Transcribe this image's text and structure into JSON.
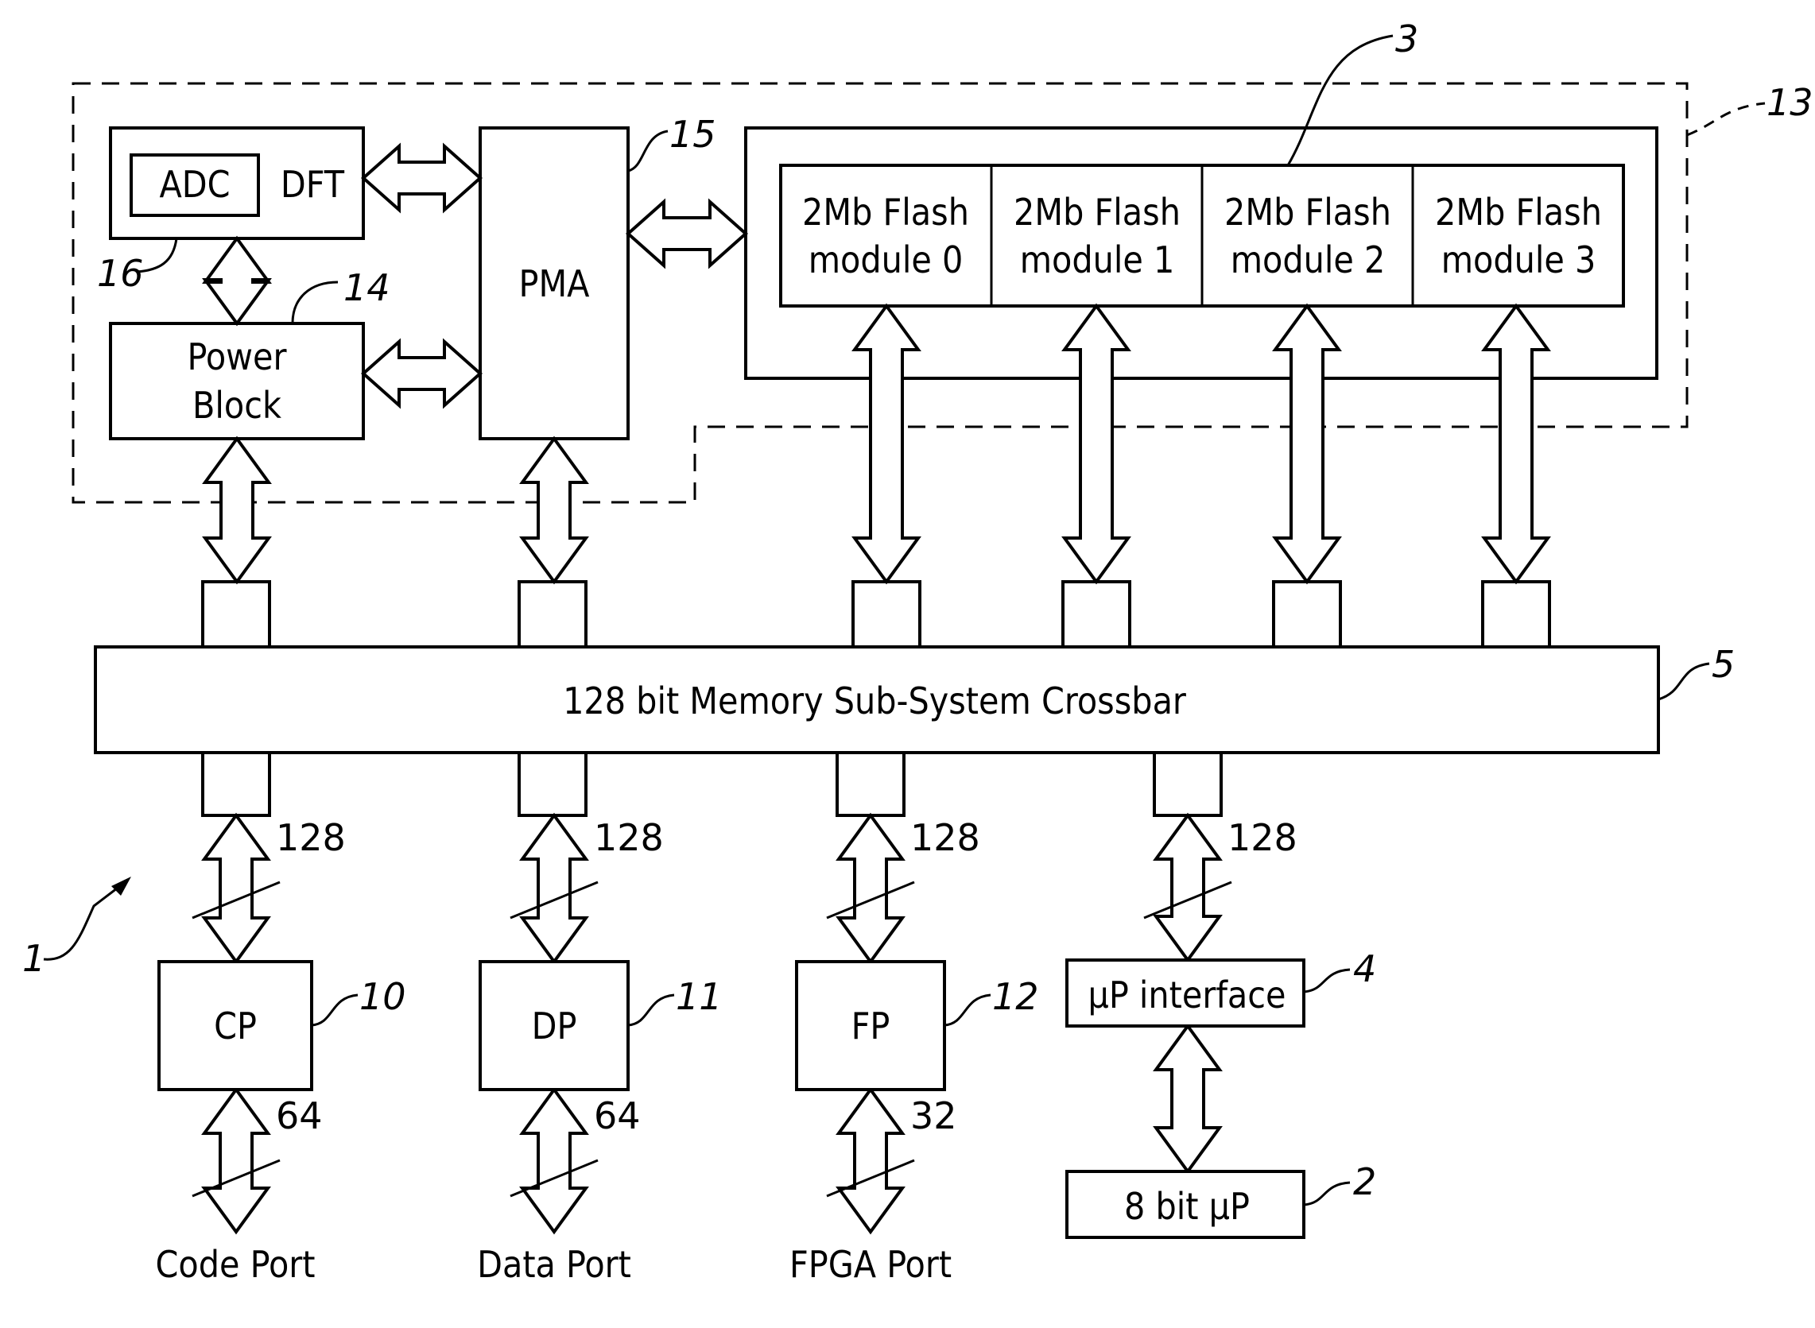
{
  "figure": {
    "system_ref": "1",
    "group_ref": "13",
    "blocks": {
      "adc": {
        "label": "ADC"
      },
      "dft": {
        "label": "DFT",
        "ref": "16"
      },
      "power": {
        "line1": "Power",
        "line2": "Block",
        "ref": "14"
      },
      "pma": {
        "label": "PMA",
        "ref": "15"
      },
      "flash_array": {
        "ref": "3"
      },
      "flash_modules": [
        {
          "line1": "2Mb Flash",
          "line2": "module 0"
        },
        {
          "line1": "2Mb Flash",
          "line2": "module 1"
        },
        {
          "line1": "2Mb Flash",
          "line2": "module 2"
        },
        {
          "line1": "2Mb Flash",
          "line2": "module 3"
        }
      ],
      "crossbar": {
        "label": "128 bit Memory Sub-System Crossbar",
        "ref": "5"
      },
      "cp": {
        "label": "CP",
        "ref": "10"
      },
      "dp": {
        "label": "DP",
        "ref": "11"
      },
      "fp": {
        "label": "FP",
        "ref": "12"
      },
      "up_interface": {
        "label": "µP interface",
        "ref": "4"
      },
      "up8": {
        "label": "8 bit µP",
        "ref": "2"
      }
    },
    "bus_widths": {
      "cp_upper": "128",
      "dp_upper": "128",
      "fp_upper": "128",
      "up_upper": "128",
      "cp_lower": "64",
      "dp_lower": "64",
      "fp_lower": "32"
    },
    "ports": {
      "code": "Code Port",
      "data": "Data Port",
      "fpga": "FPGA Port"
    }
  }
}
